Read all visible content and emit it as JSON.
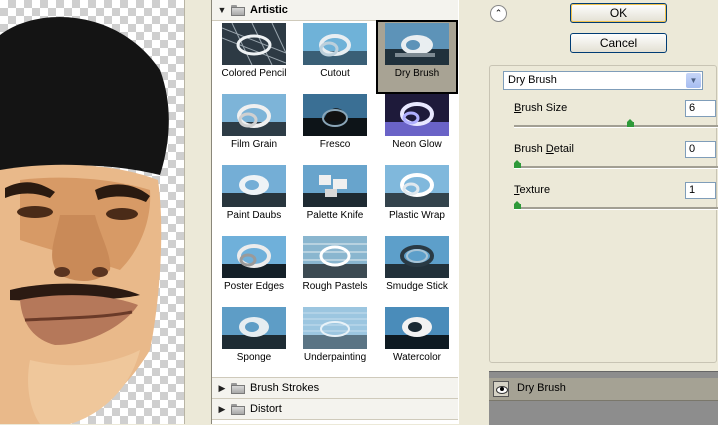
{
  "gallery": {
    "groups": {
      "artistic": "Artistic",
      "brush_strokes": "Brush Strokes",
      "distort": "Distort"
    },
    "thumbnails": [
      "Colored Pencil",
      "Cutout",
      "Dry Brush",
      "Film Grain",
      "Fresco",
      "Neon Glow",
      "Paint Daubs",
      "Palette Knife",
      "Plastic Wrap",
      "Poster Edges",
      "Rough Pastels",
      "Smudge Stick",
      "Sponge",
      "Underpainting",
      "Watercolor"
    ],
    "selected": "Dry Brush"
  },
  "buttons": {
    "ok": "OK",
    "cancel": "Cancel"
  },
  "settings": {
    "filter": "Dry Brush",
    "params": [
      {
        "pre": "",
        "key": "B",
        "post": "rush Size",
        "value": "6",
        "level": 0.57
      },
      {
        "pre": "Brush ",
        "key": "D",
        "post": "etail",
        "value": "0",
        "level": 0.0
      },
      {
        "pre": "",
        "key": "T",
        "post": "exture",
        "value": "1",
        "level": 0.0
      }
    ]
  },
  "layers": {
    "active": "Dry Brush"
  },
  "colors": {
    "selection": "#a8a394",
    "slider": "#2f9a3a",
    "accent_border": "#003c74"
  }
}
